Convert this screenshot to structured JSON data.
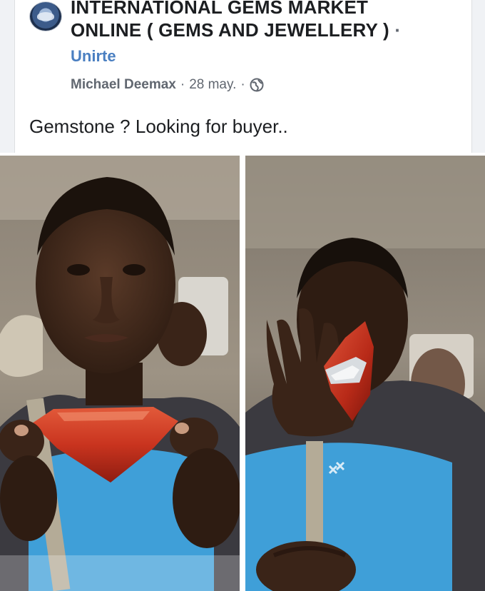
{
  "post": {
    "group_name": "INTERNATIONAL GEMS MARKET ONLINE ( GEMS AND JEWELLERY )",
    "group_separator": "·",
    "join_label": "Unirte",
    "author": "Michael Deemax",
    "date": "28 may.",
    "meta_separator": "·",
    "privacy_icon": "globe-icon",
    "text": "Gemstone ? Looking for buyer.."
  },
  "photos": [
    {
      "subject": "man-holding-red-gem-with-both-hands"
    },
    {
      "subject": "man-holding-red-gem-up-to-eye"
    }
  ],
  "colors": {
    "link": "#4a7fc1",
    "text": "#1c1e21",
    "meta": "#616770",
    "gem": "#c9341f",
    "shirt_blue": "#3f9fd8",
    "shirt_dark": "#3b3a40"
  }
}
